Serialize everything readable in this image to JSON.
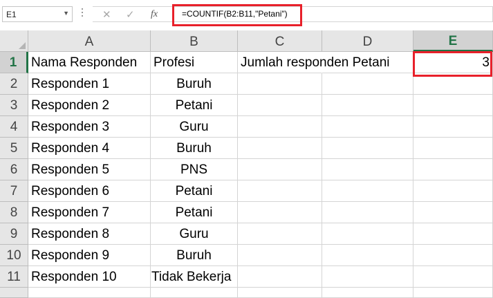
{
  "formula_bar": {
    "name_box": "E1",
    "cancel_glyph": "✕",
    "enter_glyph": "✓",
    "insert_function_glyph": "fx",
    "formula": "=COUNTIF(B2:B11,\"Petani\")"
  },
  "columns": [
    "A",
    "B",
    "C",
    "D",
    "E"
  ],
  "selected_column": "E",
  "rows": [
    "1",
    "2",
    "3",
    "4",
    "5",
    "6",
    "7",
    "8",
    "9",
    "10",
    "11"
  ],
  "selected_row": "1",
  "sheet": {
    "r1": {
      "a": "Nama Responden",
      "b": "Profesi",
      "c": "Jumlah responden Petani",
      "e": "3"
    },
    "r2": {
      "a": "Responden 1",
      "b": "Buruh"
    },
    "r3": {
      "a": "Responden 2",
      "b": "Petani"
    },
    "r4": {
      "a": "Responden 3",
      "b": "Guru"
    },
    "r5": {
      "a": "Responden 4",
      "b": "Buruh"
    },
    "r6": {
      "a": "Responden 5",
      "b": "PNS"
    },
    "r7": {
      "a": "Responden 6",
      "b": "Petani"
    },
    "r8": {
      "a": "Responden 7",
      "b": "Petani"
    },
    "r9": {
      "a": "Responden 8",
      "b": "Guru"
    },
    "r10": {
      "a": "Responden 9",
      "b": "Buruh"
    },
    "r11": {
      "a": "Responden 10",
      "b": "Tidak Bekerja"
    }
  },
  "colors": {
    "highlight": "#e8202a",
    "selection_accent": "#217346",
    "header_bg": "#e6e6e6"
  }
}
